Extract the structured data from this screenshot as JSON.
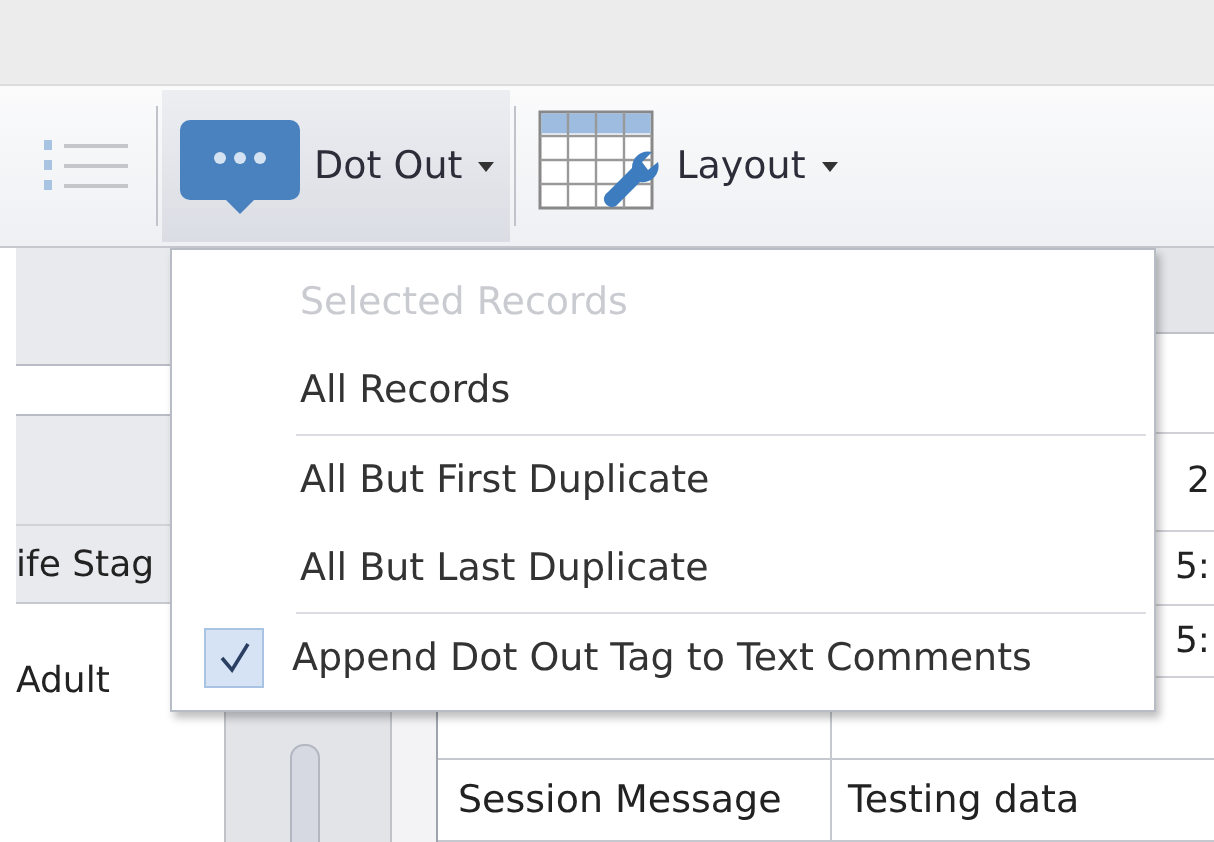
{
  "toolbar": {
    "buttons": [
      {
        "kind": "numbering",
        "pressed": false
      },
      {
        "kind": "dot_out",
        "label": "Dot Out",
        "pressed": true,
        "dropdown": true
      },
      {
        "kind": "layout",
        "label": "Layout",
        "pressed": false,
        "dropdown": true
      }
    ]
  },
  "left_panel": {
    "rows": [
      "ife Stag",
      "Adult"
    ]
  },
  "table": {
    "cells": [
      "2",
      "5:",
      "5:"
    ],
    "rows": [
      {
        "label": "Session Message",
        "value": "Testing data"
      }
    ]
  },
  "menu": {
    "items": [
      {
        "kind": "item",
        "label": "Selected Records",
        "disabled": true
      },
      {
        "kind": "item",
        "label": "All Records",
        "disabled": false
      },
      {
        "kind": "separator"
      },
      {
        "kind": "item",
        "label": "All But First Duplicate",
        "disabled": false
      },
      {
        "kind": "item",
        "label": "All But Last Duplicate",
        "disabled": false
      },
      {
        "kind": "separator"
      },
      {
        "kind": "check",
        "label": "Append Dot Out Tag to Text Comments",
        "checked": true,
        "disabled": false
      }
    ]
  }
}
